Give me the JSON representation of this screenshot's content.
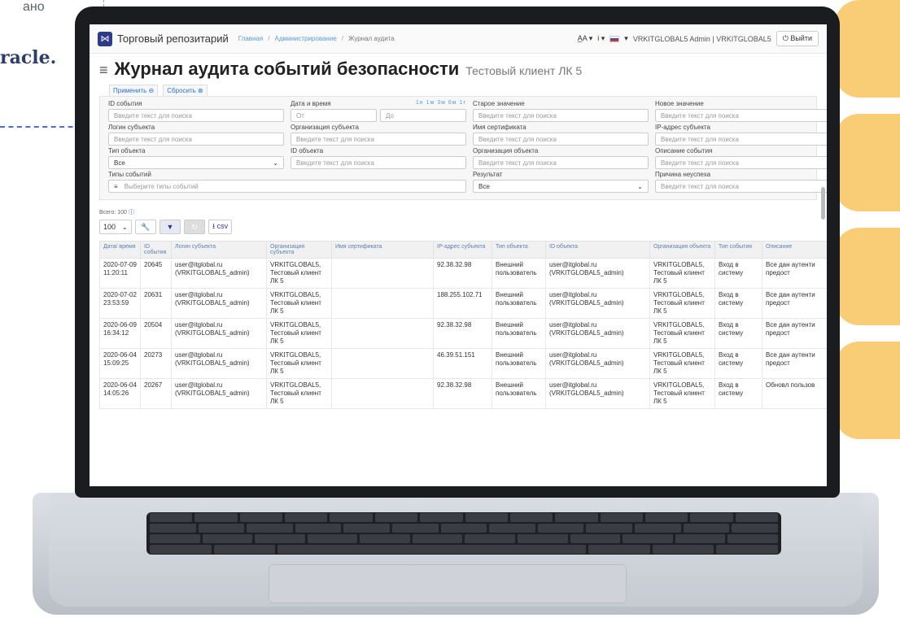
{
  "background_text": {
    "top": "ано",
    "brand": "racle."
  },
  "navbar": {
    "logo": "⋈",
    "app_title": "Торговый репозитарий",
    "breadcrumbs": [
      "Главная",
      "Администрирование"
    ],
    "breadcrumb_current": "Журнал аудита",
    "font_menu": "A̲A ▾",
    "info_menu": "i ▾",
    "lang_menu": "▾",
    "user": "VRKITGLOBAL5 Admin | VRKITGLOBAL5",
    "logout": "⏻ Выйти"
  },
  "page": {
    "title": "Журнал аудита событий безопасности",
    "subtitle": "Тестовый клиент ЛК 5"
  },
  "filter_actions": {
    "apply": "Применить ⊖",
    "reset": "Сбросить ⊗"
  },
  "filters": {
    "placeholder": "Введите текст для поиска",
    "event_id": "ID события",
    "datetime": "Дата и время",
    "quick_ranges": "1н 1м 3м 6м 1г",
    "from": "От",
    "to": "До",
    "old_value": "Старое значение",
    "new_value": "Новое значение",
    "subject_login": "Логин субъекта",
    "subject_org": "Организация субъекта",
    "cert_name": "Имя сертификата",
    "subject_ip": "IP-адрес субъекта",
    "object_type": "Тип объекта",
    "object_type_value": "Все",
    "object_id": "ID объекта",
    "object_org": "Организация объекта",
    "event_desc": "Описание события",
    "event_types": "Типы событий",
    "event_types_placeholder": "Выберите типы событий",
    "result": "Результат",
    "result_value": "Все",
    "fail_reason": "Причина неуспеха"
  },
  "total": "Всего: 100",
  "toolbar": {
    "page_size": "100",
    "csv": "⭳ csv"
  },
  "table": {
    "headers": [
      "Дата/ время",
      "ID события",
      "Логин субъекта",
      "Организация субъекта",
      "Имя сертификата",
      "IP-адрес субъекта",
      "Тип объекта",
      "ID объекта",
      "Организация объекта",
      "Тип события",
      "Описание"
    ],
    "rows": [
      [
        "2020-07-09 11:20:11",
        "20645",
        "user@itglobal.ru (VRKITGLOBAL5_admin)",
        "VRKITGLOBAL5, Тестовый клиент ЛК 5",
        "",
        "92.38.32.98",
        "Внешний пользователь",
        "user@itglobal.ru (VRKITGLOBAL5_admin)",
        "VRKITGLOBAL5, Тестовый клиент ЛК 5",
        "Вход в систему",
        "Все дан аутенти предост"
      ],
      [
        "2020-07-02 23:53:59",
        "20631",
        "user@itglobal.ru (VRKITGLOBAL5_admin)",
        "VRKITGLOBAL5, Тестовый клиент ЛК 5",
        "",
        "188.255.102.71",
        "Внешний пользователь",
        "user@itglobal.ru (VRKITGLOBAL5_admin)",
        "VRKITGLOBAL5, Тестовый клиент ЛК 5",
        "Вход в систему",
        "Все дан аутенти предост"
      ],
      [
        "2020-06-09 16:34:12",
        "20504",
        "user@itglobal.ru (VRKITGLOBAL5_admin)",
        "VRKITGLOBAL5, Тестовый клиент ЛК 5",
        "",
        "92.38.32.98",
        "Внешний пользователь",
        "user@itglobal.ru (VRKITGLOBAL5_admin)",
        "VRKITGLOBAL5, Тестовый клиент ЛК 5",
        "Вход в систему",
        "Все дан аутенти предост"
      ],
      [
        "2020-06-04 15:09:25",
        "20273",
        "user@itglobal.ru (VRKITGLOBAL5_admin)",
        "VRKITGLOBAL5, Тестовый клиент ЛК 5",
        "",
        "46.39.51.151",
        "Внешний пользователь",
        "user@itglobal.ru (VRKITGLOBAL5_admin)",
        "VRKITGLOBAL5, Тестовый клиент ЛК 5",
        "Вход в систему",
        "Все дан аутенти предост"
      ],
      [
        "2020-06-04 14:05:26",
        "20267",
        "user@itglobal.ru (VRKITGLOBAL5_admin)",
        "VRKITGLOBAL5, Тестовый клиент ЛК 5",
        "",
        "92.38.32.98",
        "Внешний пользователь",
        "user@itglobal.ru (VRKITGLOBAL5_admin)",
        "VRKITGLOBAL5, Тестовый клиент ЛК 5",
        "Вход в систему",
        "Обновл пользов"
      ]
    ]
  }
}
